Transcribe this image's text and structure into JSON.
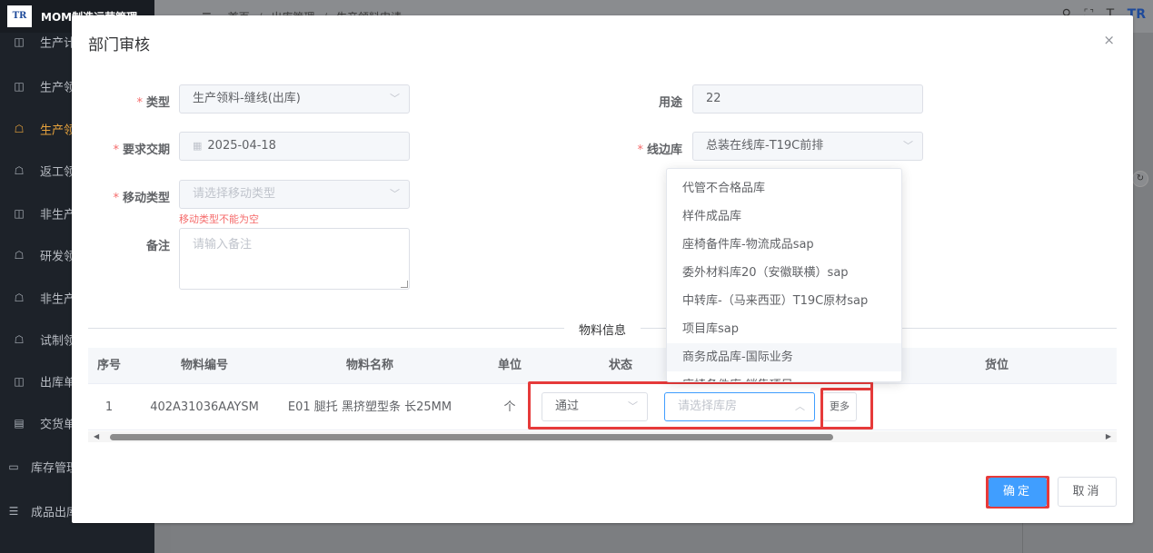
{
  "app": {
    "logo_text": "TR",
    "title": "MOM制造运营管理",
    "breadcrumb": [
      "首页",
      "出库管理",
      "生产领料申请"
    ],
    "top_icons": [
      "search-icon",
      "fullscreen-icon",
      "font-size-icon",
      "avatar"
    ]
  },
  "sidebar": {
    "items": [
      {
        "label": "生产计",
        "icon": "book-icon"
      },
      {
        "label": "生产领",
        "icon": "book-icon"
      },
      {
        "label": "生产领",
        "icon": "chat-icon",
        "active": true
      },
      {
        "label": "返工领",
        "icon": "chat-icon"
      },
      {
        "label": "非生产",
        "icon": "book-icon"
      },
      {
        "label": "研发领",
        "icon": "chat-icon"
      },
      {
        "label": "非生产",
        "icon": "chat-icon"
      },
      {
        "label": "试制领",
        "icon": "chat-icon"
      },
      {
        "label": "出库单",
        "icon": "book-icon"
      },
      {
        "label": "交货单",
        "icon": "grid-icon"
      },
      {
        "label": "库存管理",
        "icon": "monitor-icon"
      },
      {
        "label": "成品出库",
        "icon": "list-icon"
      }
    ]
  },
  "dialog": {
    "title": "部门审核",
    "close_icon": "×",
    "form": {
      "type_label": "类型",
      "type_value": "生产领料-缝线(出库)",
      "purpose_label": "用途",
      "purpose_value": "22",
      "due_label": "要求交期",
      "due_value": "2025-04-18",
      "line_warehouse_label": "线边库",
      "line_warehouse_value": "总装在线库-T19C前排",
      "move_type_label": "移动类型",
      "move_type_placeholder": "请选择移动类型",
      "move_type_error": "移动类型不能为空",
      "remark_label": "备注",
      "remark_placeholder": "请输入备注"
    },
    "divider_text": "物料信息",
    "table": {
      "headers": [
        "序号",
        "物料编号",
        "物料名称",
        "单位",
        "状态",
        "",
        "货位"
      ],
      "rows": [
        {
          "index": "1",
          "code": "402A31036AAYSM",
          "name": "E01 腿托 黑挤塑型条 长25MM",
          "unit": "个",
          "status": "通过",
          "warehouse_placeholder": "请选择库房",
          "more_label": "更多"
        }
      ]
    },
    "buttons": {
      "ok": "确定",
      "cancel": "取消"
    }
  },
  "dropdown": {
    "options": [
      "代管不合格品库",
      "样件成品库",
      "座椅备件库-物流成品sap",
      "委外材料库20（安徽联横）sap",
      "中转库-（马来西亚）T19C原材sap",
      "项目库sap",
      "商务成品库-国际业务",
      "座椅备件库-销售项目sap"
    ],
    "hovered_index": 6
  },
  "colors": {
    "primary": "#409eff",
    "error": "#f56c6c",
    "highlight_outline": "#e63a3a",
    "sidebar_active": "#e6a23c"
  }
}
